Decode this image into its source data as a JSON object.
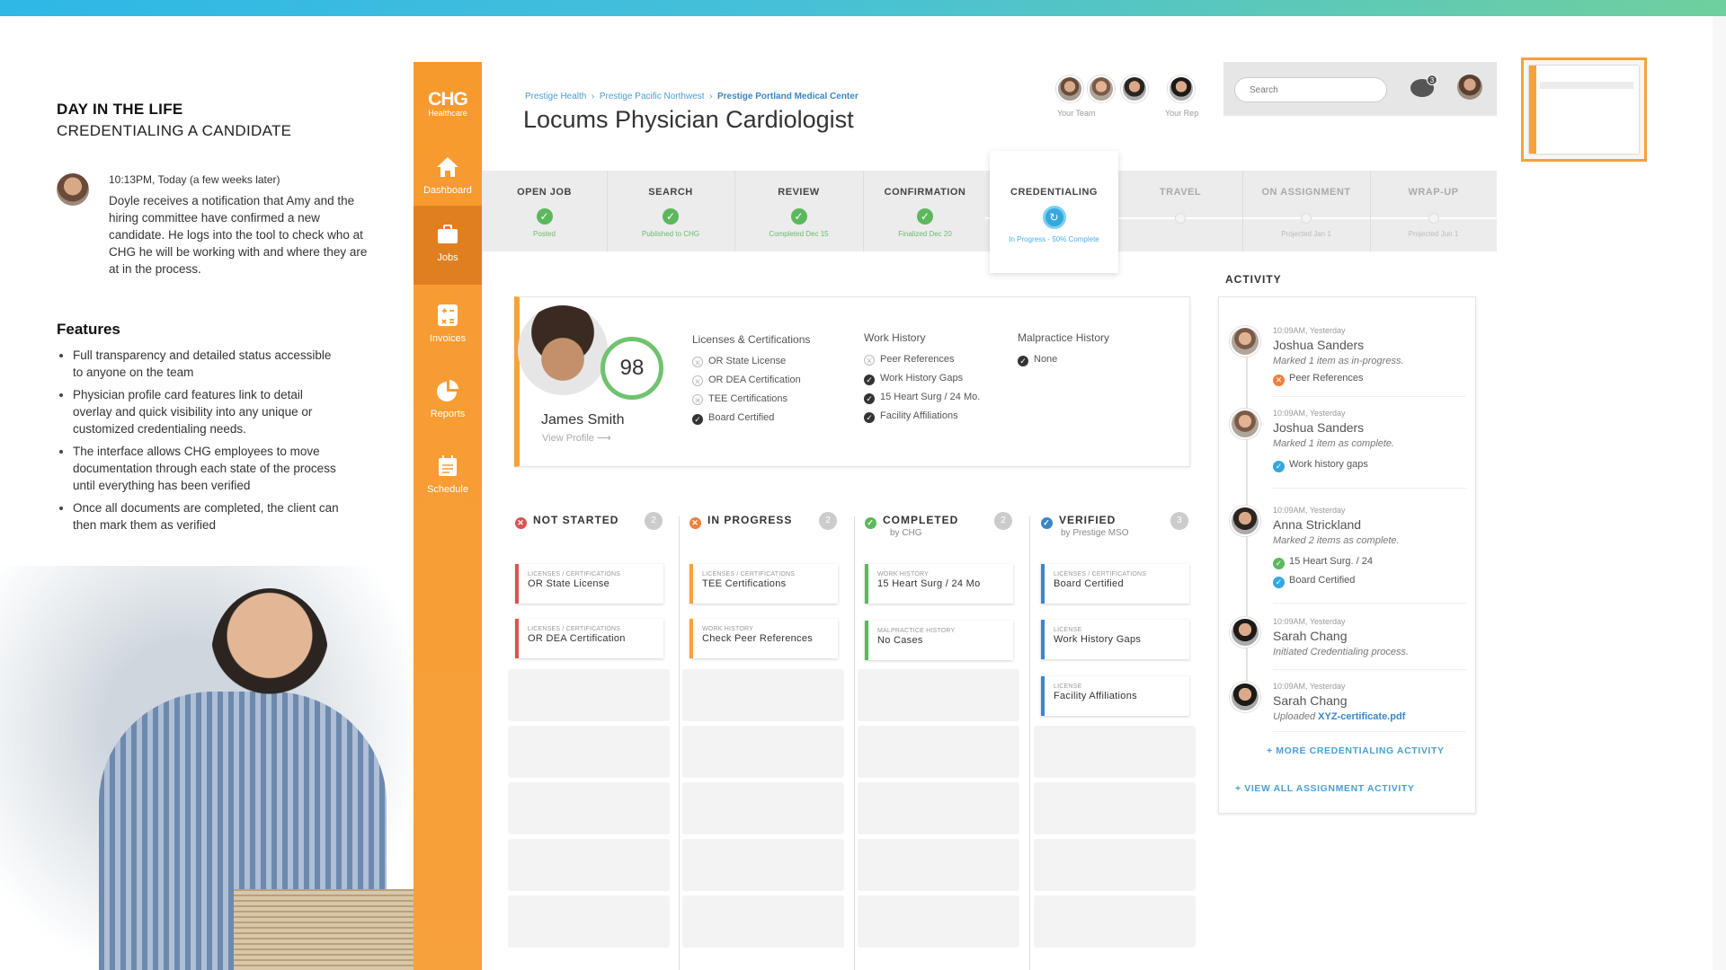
{
  "narrative": {
    "heading": "DAY IN THE LIFE",
    "subheading": "CREDENTIALING A CANDIDATE",
    "timestamp": "10:13PM, Today (a few weeks later)",
    "story": "Doyle receives a notification that Amy and the hiring committee have confirmed a new candidate. He logs into the tool to check who at CHG he will be working with and where they are at in the process.",
    "features_title": "Features",
    "features": [
      "Full transparency and detailed status accessible to anyone on the team",
      "Physician profile card features link to detail overlay and quick visibility into any unique or customized credentialing needs.",
      "The interface allows CHG employees to move documentation through each state of the process until everything has been verified",
      "Once all documents are completed, the client can then mark them as verified"
    ]
  },
  "brand": {
    "name": "CHG",
    "sub": "Healthcare",
    "accent": "#f7a13c"
  },
  "nav": [
    {
      "label": "Dashboard",
      "icon": "home-icon"
    },
    {
      "label": "Jobs",
      "icon": "briefcase-icon",
      "active": true
    },
    {
      "label": "Invoices",
      "icon": "calculator-icon"
    },
    {
      "label": "Reports",
      "icon": "pie-chart-icon"
    },
    {
      "label": "Schedule",
      "icon": "calendar-icon"
    }
  ],
  "breadcrumb": [
    "Prestige Health",
    "Prestige Pacific Northwest",
    "Prestige Portland Medical Center"
  ],
  "page_title": "Locums Physician Cardiologist",
  "team": {
    "team_label": "Your Team",
    "rep_label": "Your Rep"
  },
  "search": {
    "placeholder": "Search"
  },
  "notifications": {
    "count": "3"
  },
  "steps": [
    {
      "label": "OPEN JOB",
      "status": "Posted",
      "state": "done"
    },
    {
      "label": "SEARCH",
      "status": "Published to CHG",
      "state": "done"
    },
    {
      "label": "REVIEW",
      "status": "Completed Dec 15",
      "state": "done"
    },
    {
      "label": "CONFIRMATION",
      "status": "Finalized Dec 20",
      "state": "done"
    },
    {
      "label": "CREDENTIALING",
      "status": "In Progress - 50% Complete",
      "state": "current"
    },
    {
      "label": "TRAVEL",
      "status": "",
      "state": "future"
    },
    {
      "label": "ON ASSIGNMENT",
      "status": "Projected Jan 1",
      "state": "future"
    },
    {
      "label": "WRAP-UP",
      "status": "Projected Jun 1",
      "state": "future"
    }
  ],
  "profile": {
    "name": "James Smith",
    "score": "98",
    "view_link": "View Profile",
    "licenses_title": "Licenses & Certifications",
    "licenses": [
      {
        "label": "OR State License",
        "done": false
      },
      {
        "label": "OR DEA Certification",
        "done": false
      },
      {
        "label": "TEE Certifications",
        "done": false
      },
      {
        "label": "Board Certified",
        "done": true
      }
    ],
    "work_title": "Work History",
    "work": [
      {
        "label": "Peer References",
        "done": false
      },
      {
        "label": "Work History Gaps",
        "done": true
      },
      {
        "label": "15 Heart Surg / 24 Mo.",
        "done": true
      },
      {
        "label": "Facility Affiliations",
        "done": true
      }
    ],
    "malpractice_title": "Malpractice History",
    "malpractice": [
      {
        "label": "None",
        "done": true
      }
    ]
  },
  "kanban": [
    {
      "title": "NOT STARTED",
      "sub": "",
      "count": "2",
      "color": "#d9534f",
      "icon": "✕",
      "tiles": [
        {
          "category": "LICENSES / CERTIFICATIONS",
          "value": "OR State License"
        },
        {
          "category": "LICENSES / CERTIFICATIONS",
          "value": "OR DEA Certification"
        }
      ]
    },
    {
      "title": "IN PROGRESS",
      "sub": "",
      "count": "2",
      "color": "#f0803c",
      "icon": "✕",
      "tiles": [
        {
          "category": "LICENSES / CERTIFICATIONS",
          "value": "TEE Certifications"
        },
        {
          "category": "WORK HISTORY",
          "value": "Check Peer References"
        }
      ]
    },
    {
      "title": "COMPLETED",
      "sub": "by CHG",
      "count": "2",
      "color": "#5cb85c",
      "icon": "✓",
      "tiles": [
        {
          "category": "WORK HISTORY",
          "value": "15 Heart Surg / 24 Mo"
        },
        {
          "category": "MALPRACTICE HISTORY",
          "value": "No Cases"
        }
      ]
    },
    {
      "title": "VERIFIED",
      "sub": "by Prestige MSO",
      "count": "3",
      "color": "#3b86c6",
      "icon": "✓",
      "tiles": [
        {
          "category": "LICENSES / CERTIFICATIONS",
          "value": "Board Certified"
        },
        {
          "category": "LICENSE",
          "value": "Work History Gaps"
        },
        {
          "category": "LICENSE",
          "value": "Facility Affiliations"
        }
      ]
    }
  ],
  "activity": {
    "title": "ACTIVITY",
    "items": [
      {
        "time": "10:09AM, Yesterday",
        "name": "Joshua Sanders",
        "desc": "Marked 1 item as in-progress.",
        "subs": [
          {
            "label": "Peer References",
            "color": "#f0803c",
            "mark": "✕"
          }
        ]
      },
      {
        "time": "10:09AM, Yesterday",
        "name": "Joshua Sanders",
        "desc": "Marked 1 item as complete.",
        "subs": [
          {
            "label": "Work history gaps",
            "color": "#35a8df",
            "mark": "✓"
          }
        ]
      },
      {
        "time": "10:09AM, Yesterday",
        "name": "Anna Strickland",
        "desc": "Marked 2 items as complete.",
        "subs": [
          {
            "label": "15 Heart Surg. / 24",
            "color": "#5cb85c",
            "mark": "✓"
          },
          {
            "label": "Board Certified",
            "color": "#35a8df",
            "mark": "✓"
          }
        ]
      },
      {
        "time": "10:09AM, Yesterday",
        "name": "Sarah Chang",
        "desc": "Initiated Credentialing process.",
        "subs": []
      },
      {
        "time": "10:09AM, Yesterday",
        "name": "Sarah Chang",
        "desc": "Uploaded ",
        "file": "XYZ-certificate.pdf",
        "subs": []
      }
    ],
    "more_link": "+ MORE CREDENTIALING ACTIVITY",
    "all_link": "+ VIEW ALL ASSIGNMENT ACTIVITY"
  }
}
